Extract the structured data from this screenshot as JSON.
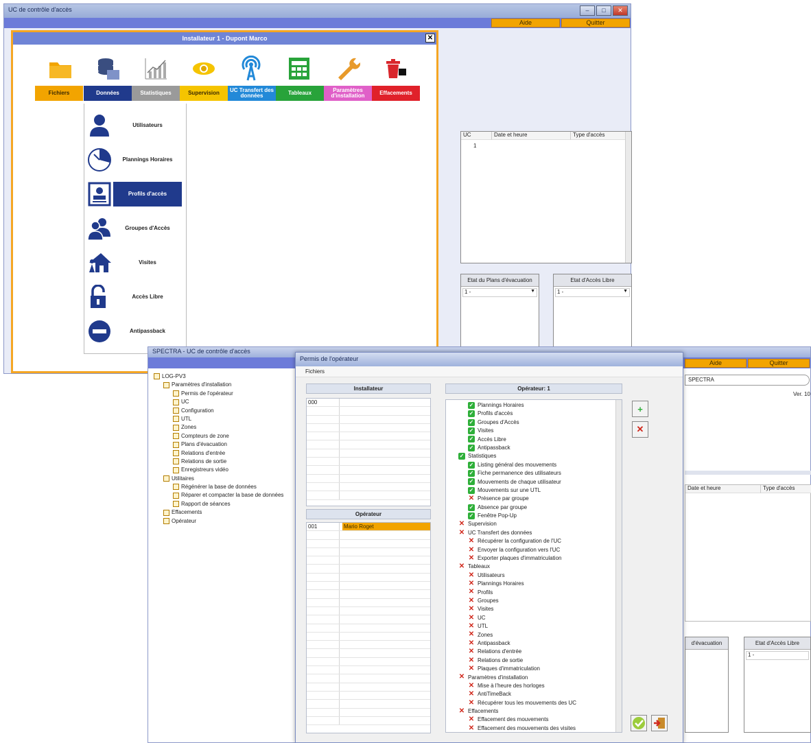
{
  "win1": {
    "title": "UC de contrôle d'accès",
    "menu_buttons": [
      "Aide",
      "Quitter"
    ],
    "dialog_title": "Installateur 1 - Dupont Marco",
    "categories": [
      {
        "label": "Fichiers",
        "icon": "folder-icon",
        "color": "#f2a400"
      },
      {
        "label": "Données",
        "icon": "database-icon",
        "color": "#203a8c"
      },
      {
        "label": "Statistiques",
        "icon": "chart-icon",
        "color": "#9a9a9a"
      },
      {
        "label": "Supervision",
        "icon": "eye-icon",
        "color": "#f5c400"
      },
      {
        "label": "UC Transfert des données",
        "icon": "antenna-icon",
        "color": "#2289d8"
      },
      {
        "label": "Tableaux",
        "icon": "spreadsheet-icon",
        "color": "#28a33a"
      },
      {
        "label": "Paramètres d'installation",
        "icon": "wrench-icon",
        "color": "#e060c8"
      },
      {
        "label": "Effacements",
        "icon": "trash-icon",
        "color": "#e0212a"
      }
    ],
    "submenu": [
      {
        "label": "Utilisateurs",
        "icon": "user-icon"
      },
      {
        "label": "Plannings Horaires",
        "icon": "clock-icon"
      },
      {
        "label": "Profils d'accès",
        "icon": "id-card-icon"
      },
      {
        "label": "Groupes d'Accès",
        "icon": "group-icon"
      },
      {
        "label": "Visites",
        "icon": "house-icon"
      },
      {
        "label": "Accès Libre",
        "icon": "unlock-icon"
      },
      {
        "label": "Antipassback",
        "icon": "no-entry-icon"
      }
    ],
    "log_headers": [
      "UC",
      "Date et heure",
      "Type d'accès"
    ],
    "log_first_value": "1",
    "panel_left_title": "Etat du Plans d'évacuation",
    "panel_right_title": "Etat d'Accès Libre",
    "combo_value": "1 -"
  },
  "win2": {
    "title": "SPECTRA - UC de contrôle d'accès",
    "menu_buttons": [
      "Aide",
      "Quitter"
    ],
    "right_label": "SPECTRA",
    "version": "Ver. 10",
    "log_headers": [
      "Date et heure",
      "Type d'accès"
    ],
    "panel_left_title": "d'évacuation",
    "panel_right_title": "Etat d'Accès Libre",
    "combo_value": "1 -",
    "tree": [
      {
        "label": "LOG-PV3",
        "level": 0
      },
      {
        "label": "Paramètres d'installation",
        "level": 1
      },
      {
        "label": "Permis de l'opérateur",
        "level": 2
      },
      {
        "label": "UC",
        "level": 2
      },
      {
        "label": "Configuration",
        "level": 2
      },
      {
        "label": "UTL",
        "level": 2
      },
      {
        "label": "Zones",
        "level": 2
      },
      {
        "label": "Compteurs de zone",
        "level": 2
      },
      {
        "label": "Plans d'évacuation",
        "level": 2
      },
      {
        "label": "Relations d'entrée",
        "level": 2
      },
      {
        "label": "Relations de sortie",
        "level": 2
      },
      {
        "label": "Enregistreurs vidéo",
        "level": 2
      },
      {
        "label": "Utilitaires",
        "level": 1
      },
      {
        "label": "Régénérer la base de données",
        "level": 2
      },
      {
        "label": "Réparer et compacter la base de données",
        "level": 2
      },
      {
        "label": "Rapport de séances",
        "level": 2
      },
      {
        "label": "Effacements",
        "level": 1
      },
      {
        "label": "Opérateur",
        "level": 1
      }
    ]
  },
  "perm": {
    "title": "Permis de l'opérateur",
    "menu": "Fichiers",
    "installateur_header": "Installateur",
    "installateur_rows": [
      {
        "id": "000",
        "name": ""
      }
    ],
    "operateur_header": "Opérateur",
    "operateur_rows": [
      {
        "id": "001",
        "name": "Mario Roget"
      }
    ],
    "permissions_header": "Opérateur: 1",
    "permissions": [
      {
        "label": "Plannings Horaires",
        "level": 2,
        "ok": true
      },
      {
        "label": "Profils d'accès",
        "level": 2,
        "ok": true
      },
      {
        "label": "Groupes d'Accès",
        "level": 2,
        "ok": true
      },
      {
        "label": "Visites",
        "level": 2,
        "ok": true
      },
      {
        "label": "Accès Libre",
        "level": 2,
        "ok": true
      },
      {
        "label": "Antipassback",
        "level": 2,
        "ok": true
      },
      {
        "label": "Statistiques",
        "level": 1,
        "ok": true
      },
      {
        "label": "Listing général des mouvements",
        "level": 2,
        "ok": true
      },
      {
        "label": "Fiche permanence des utilisateurs",
        "level": 2,
        "ok": true
      },
      {
        "label": "Mouvements de chaque utilisateur",
        "level": 2,
        "ok": true
      },
      {
        "label": "Mouvements sur une UTL",
        "level": 2,
        "ok": true
      },
      {
        "label": "Présence par groupe",
        "level": 2,
        "ok": false
      },
      {
        "label": "Absence par groupe",
        "level": 2,
        "ok": true
      },
      {
        "label": "Fenêtre Pop-Up",
        "level": 2,
        "ok": true
      },
      {
        "label": "Supervision",
        "level": 1,
        "ok": false
      },
      {
        "label": "UC Transfert des données",
        "level": 1,
        "ok": false
      },
      {
        "label": "Récupérer la configuration de l'UC",
        "level": 2,
        "ok": false
      },
      {
        "label": "Envoyer la configuration vers l'UC",
        "level": 2,
        "ok": false
      },
      {
        "label": "Exporter plaques d'immatriculation",
        "level": 2,
        "ok": false
      },
      {
        "label": "Tableaux",
        "level": 1,
        "ok": false
      },
      {
        "label": "Utilisateurs",
        "level": 2,
        "ok": false
      },
      {
        "label": "Plannings Horaires",
        "level": 2,
        "ok": false
      },
      {
        "label": "Profils",
        "level": 2,
        "ok": false
      },
      {
        "label": "Groupes",
        "level": 2,
        "ok": false
      },
      {
        "label": "Visites",
        "level": 2,
        "ok": false
      },
      {
        "label": "UC",
        "level": 2,
        "ok": false
      },
      {
        "label": "UTL",
        "level": 2,
        "ok": false
      },
      {
        "label": "Zones",
        "level": 2,
        "ok": false
      },
      {
        "label": "Antipassback",
        "level": 2,
        "ok": false
      },
      {
        "label": "Relations d'entrée",
        "level": 2,
        "ok": false
      },
      {
        "label": "Relations de sortie",
        "level": 2,
        "ok": false
      },
      {
        "label": "Plaques d'immatriculation",
        "level": 2,
        "ok": false
      },
      {
        "label": "Paramètres d'installation",
        "level": 1,
        "ok": false
      },
      {
        "label": "Mise à l'heure des horloges",
        "level": 2,
        "ok": false
      },
      {
        "label": "AntiTimeBack",
        "level": 2,
        "ok": false
      },
      {
        "label": "Récupérer tous les mouvements des UC",
        "level": 2,
        "ok": false
      },
      {
        "label": "Effacements",
        "level": 1,
        "ok": false
      },
      {
        "label": "Effacement des mouvements",
        "level": 2,
        "ok": false
      },
      {
        "label": "Effacement des mouvements des visites",
        "level": 2,
        "ok": false
      }
    ]
  }
}
